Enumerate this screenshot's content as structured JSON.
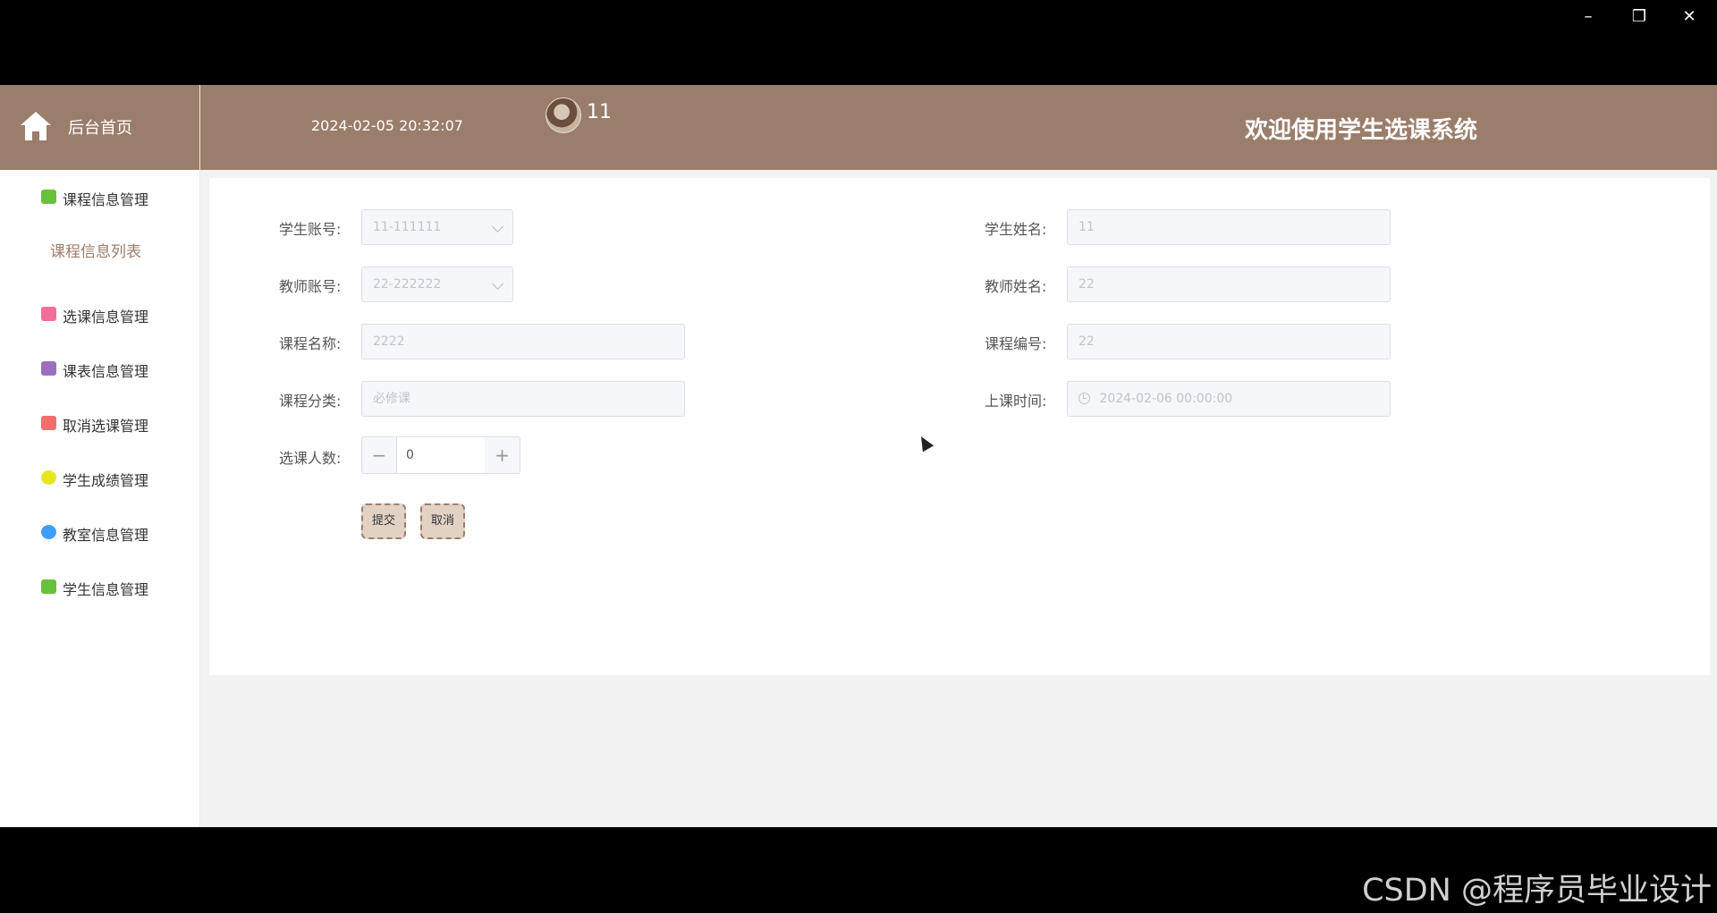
{
  "window": {
    "minimize_icon": "minimize-icon",
    "maximize_icon": "restore-icon",
    "close_icon": "close-icon"
  },
  "header": {
    "home_label": "后台首页",
    "datetime": "2024-02-05 20:32:07",
    "username": "11",
    "welcome": "欢迎使用学生选课系统"
  },
  "sidebar": {
    "items": [
      {
        "label": "课程信息管理",
        "color": "#67c23a"
      },
      {
        "label": "课程信息列表",
        "sub": true
      },
      {
        "label": "选课信息管理",
        "color": "#f56c9c"
      },
      {
        "label": "课表信息管理",
        "color": "#9b6fbf"
      },
      {
        "label": "取消选课管理",
        "color": "#f56c6c"
      },
      {
        "label": "学生成绩管理",
        "color": "#e6e61f"
      },
      {
        "label": "教室信息管理",
        "color": "#409eff"
      },
      {
        "label": "学生信息管理",
        "color": "#67c23a"
      }
    ]
  },
  "form": {
    "student_account": {
      "label": "学生账号:",
      "value": "11-111111"
    },
    "student_name": {
      "label": "学生姓名:",
      "value": "11"
    },
    "teacher_account": {
      "label": "教师账号:",
      "value": "22-222222"
    },
    "teacher_name": {
      "label": "教师姓名:",
      "value": "22"
    },
    "course_name": {
      "label": "课程名称:",
      "value": "2222"
    },
    "course_code": {
      "label": "课程编号:",
      "value": "22"
    },
    "course_category": {
      "label": "课程分类:",
      "value": "必修课"
    },
    "class_time": {
      "label": "上课时间:",
      "value": "2024-02-06 00:00:00"
    },
    "enroll_count": {
      "label": "选课人数:",
      "value": "0"
    },
    "submit_label": "提交",
    "cancel_label": "取消"
  },
  "footer": {
    "watermark": "CSDN @程序员毕业设计"
  }
}
